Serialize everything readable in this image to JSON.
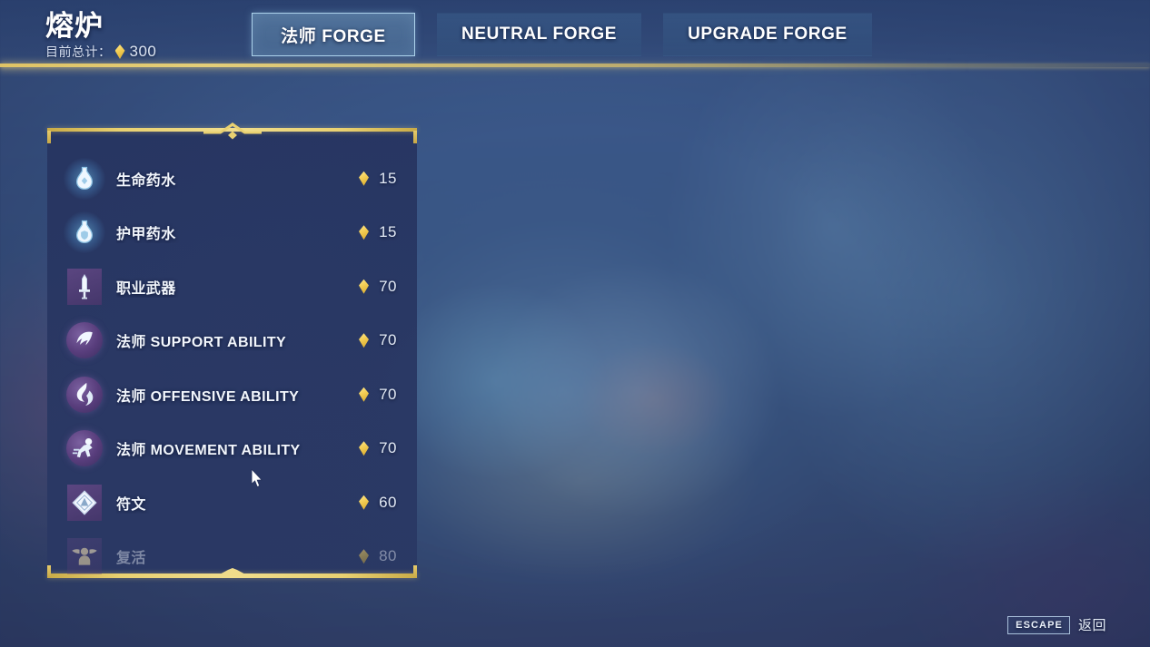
{
  "header": {
    "title": "熔炉",
    "subtitle_label": "目前总计：",
    "coin_icon": "coin-diamond-icon",
    "coin_total": "300"
  },
  "tabs": [
    {
      "label": "法师 FORGE",
      "active": true,
      "name": "tab-mage-forge"
    },
    {
      "label": "NEUTRAL FORGE",
      "active": false,
      "name": "tab-neutral-forge"
    },
    {
      "label": "UPGRADE FORGE",
      "active": false,
      "name": "tab-upgrade-forge"
    }
  ],
  "panel": {
    "items": [
      {
        "label": "生命药水",
        "price": "15",
        "icon": "health-potion-icon",
        "icon_style": "blue",
        "disabled": false
      },
      {
        "label": "护甲药水",
        "price": "15",
        "icon": "armor-potion-icon",
        "icon_style": "blue",
        "disabled": false
      },
      {
        "label": "职业武器",
        "price": "70",
        "icon": "class-weapon-icon",
        "icon_style": "purple",
        "disabled": false
      },
      {
        "label": "法师 SUPPORT ABILITY",
        "price": "70",
        "icon": "support-ability-icon",
        "icon_style": "purple",
        "disabled": false
      },
      {
        "label": "法师 OFFENSIVE ABILITY",
        "price": "70",
        "icon": "offensive-ability-icon",
        "icon_style": "purple",
        "disabled": false
      },
      {
        "label": "法师 MOVEMENT ABILITY",
        "price": "70",
        "icon": "movement-ability-icon",
        "icon_style": "purple",
        "disabled": false
      },
      {
        "label": "符文",
        "price": "60",
        "icon": "rune-icon",
        "icon_style": "purple",
        "disabled": false
      },
      {
        "label": "复活",
        "price": "80",
        "icon": "revive-icon",
        "icon_style": "purple",
        "disabled": true
      }
    ]
  },
  "footer": {
    "escape_key": "ESCAPE",
    "escape_label": "返回"
  },
  "colors": {
    "gold": "#e9d171",
    "accent_border": "#b2d8f0",
    "panel_bg": "#283460",
    "disabled_text": "#7e88a4"
  }
}
